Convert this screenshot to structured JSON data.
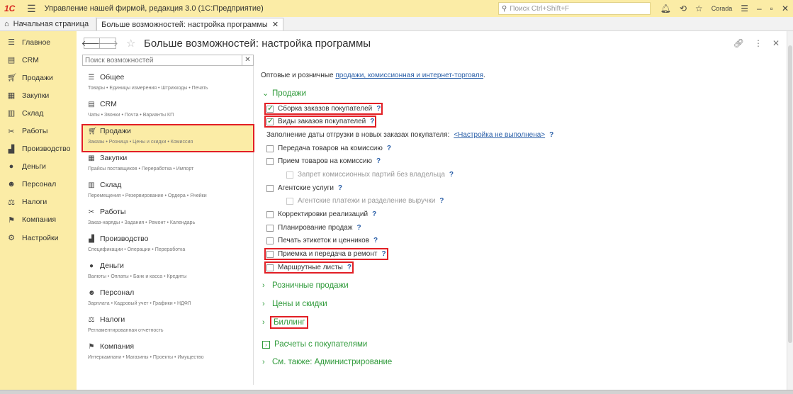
{
  "app": {
    "logo": "1С",
    "title": "Управление нашей фирмой, редакция 3.0  (1С:Предприятие)",
    "search_placeholder": "Поиск Ctrl+Shift+F",
    "user": "Corada"
  },
  "tabs": {
    "home": "Начальная страница",
    "active": "Больше возможностей: настройка программы"
  },
  "sidebar": {
    "items": [
      {
        "label": "Главное",
        "icon": "menu-lines-icon"
      },
      {
        "label": "CRM",
        "icon": "crm-icon"
      },
      {
        "label": "Продажи",
        "icon": "cart-icon"
      },
      {
        "label": "Закупки",
        "icon": "purchases-icon"
      },
      {
        "label": "Склад",
        "icon": "warehouse-icon"
      },
      {
        "label": "Работы",
        "icon": "tools-icon"
      },
      {
        "label": "Производство",
        "icon": "factory-icon"
      },
      {
        "label": "Деньги",
        "icon": "money-icon"
      },
      {
        "label": "Персонал",
        "icon": "people-icon"
      },
      {
        "label": "Налоги",
        "icon": "taxes-icon"
      },
      {
        "label": "Компания",
        "icon": "flag-icon"
      },
      {
        "label": "Настройки",
        "icon": "gear-icon"
      }
    ]
  },
  "page": {
    "title": "Больше возможностей: настройка программы",
    "search_placeholder": "Поиск возможностей"
  },
  "categories": [
    {
      "title": "Общее",
      "desc": "Товары • Единицы измерения • Штрихкоды • Печать",
      "icon": "menu-lines-icon"
    },
    {
      "title": "CRM",
      "desc": "Чаты • Звонки • Почта • Варианты КП",
      "icon": "crm-icon"
    },
    {
      "title": "Продажи",
      "desc": "Заказы • Розница • Цены и скидки • Комиссия",
      "icon": "cart-icon"
    },
    {
      "title": "Закупки",
      "desc": "Прайсы поставщиков • Переработка • Импорт",
      "icon": "purchases-icon"
    },
    {
      "title": "Склад",
      "desc": "Перемещения • Резервирование • Ордера • Ячейки",
      "icon": "warehouse-icon"
    },
    {
      "title": "Работы",
      "desc": "Заказ-наряды • Задания • Ремонт • Календарь",
      "icon": "tools-icon"
    },
    {
      "title": "Производство",
      "desc": "Спецификации • Операции • Переработка",
      "icon": "factory-icon"
    },
    {
      "title": "Деньги",
      "desc": "Валюты • Оплаты • Банк и касса • Кредиты",
      "icon": "money-icon"
    },
    {
      "title": "Персонал",
      "desc": "Зарплата • Кадровый учет • Графики • НДФЛ",
      "icon": "people-icon"
    },
    {
      "title": "Налоги",
      "desc": "Регламентированная отчетность",
      "icon": "taxes-icon"
    },
    {
      "title": "Компания",
      "desc": "Интеркампани • Магазины • Проекты • Имущество",
      "icon": "flag-icon"
    }
  ],
  "selected_category": "Продажи",
  "right": {
    "intro_text": "Оптовые и розничные ",
    "intro_link": "продажи, комиссионная и интернет-торговля",
    "intro_end": ".",
    "section_sales": "Продажи",
    "options": {
      "assembly": "Сборка заказов покупателей",
      "order_types": "Виды заказов покупателей",
      "ship_date_label": "Заполнение даты отгрузки в новых заказах покупателя:",
      "ship_date_link": "<Настройка не выполнена>",
      "consign_transfer": "Передача товаров на комиссию",
      "consign_accept": "Прием товаров на комиссию",
      "consign_ban": "Запрет комиссионных партий без владельца",
      "agent": "Агентские услуги",
      "agent_payments": "Агентские платежи и разделение выручки",
      "adjustments": "Корректировки реализаций",
      "planning": "Планирование продаж",
      "labels": "Печать этикеток и ценников",
      "repair": "Приемка и передача в ремонт",
      "routes": "Маршрутные листы"
    },
    "help": "?",
    "sections": {
      "retail": "Розничные продажи",
      "prices": "Цены и скидки",
      "billing": "Биллинг",
      "settlements": "Расчеты с покупателями",
      "see_also": "См. также: Администрирование"
    }
  },
  "colors": {
    "accent_yellow": "#fbeca6",
    "section_green": "#2f9a3a",
    "link_blue": "#2a5fa8",
    "highlight_red": "#e21f25"
  }
}
